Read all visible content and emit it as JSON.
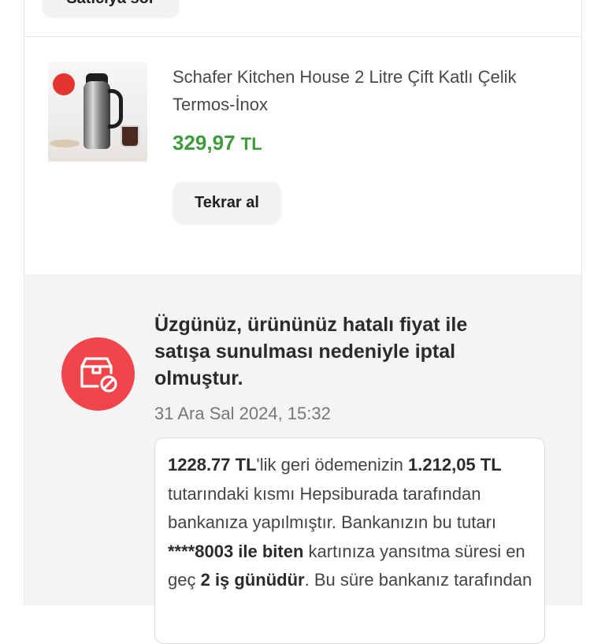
{
  "previous_item": {
    "button_label": "Satıcıya sor"
  },
  "product": {
    "name": "Schafer Kitchen House 2 Litre Çift Katlı Çelik Termos-İnox",
    "price_value": "329,97",
    "price_currency": "TL",
    "buy_again_label": "Tekrar al",
    "image_icon": "thermos-product-image"
  },
  "status": {
    "icon": "cancelled-order-icon",
    "icon_color": "#f0454a",
    "title": "Üzgünüz, ürününüz hatalı fiyat ile satışa sunulması nedeniyle iptal olmuştur.",
    "timestamp": "31 Ara Sal 2024, 15:32"
  },
  "refund_message": {
    "amount_total": "1228.77 TL",
    "t1": "'lik geri ödemenizin ",
    "amount_partial": "1.212,05 TL",
    "t2": " tutarındaki kısmı Hepsiburada tarafından bankanıza yapılmıştır. Bankanızın bu tutarı ",
    "card": "****8003 ile biten",
    "t3": " kartınıza yansıtma süresi en geç ",
    "days": "2 iş günüdür",
    "t4": ". Bu süre bankanız tarafından"
  },
  "colors": {
    "price_green": "#3f9a3a",
    "accent_red": "#f0454a"
  }
}
